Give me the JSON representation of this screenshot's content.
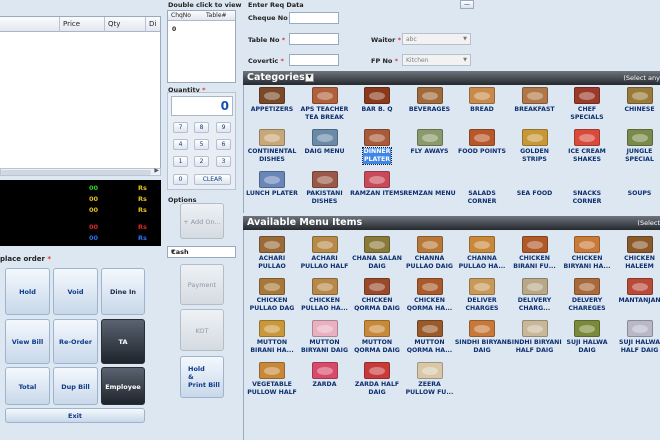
{
  "order_grid": {
    "columns": [
      "",
      "Price",
      "Qty",
      "Di"
    ]
  },
  "totals": {
    "rows": [
      {
        "value": "00",
        "value_color": "#28d428",
        "rs": "Rs",
        "rs_color": "#e8c020"
      },
      {
        "value": "00",
        "value_color": "#e8c020",
        "rs": "Rs",
        "rs_color": "#e8c020"
      },
      {
        "value": "00",
        "value_color": "#e8c020",
        "rs": "Rs",
        "rs_color": "#e8c020"
      },
      {
        "value": "00",
        "value_color": "#e02828",
        "rs": "Rs",
        "rs_color": "#e02828"
      },
      {
        "value": "00",
        "value_color": "#3070f0",
        "rs": "Rs",
        "rs_color": "#3070f0"
      }
    ]
  },
  "place_order": {
    "label": "place order",
    "req": "*",
    "buttons": {
      "hold": "Hold",
      "void": "Void",
      "dine_in": "Dine In",
      "view_bill": "View Bill",
      "re_order": "Re-Order",
      "ta": "TA",
      "total": "Total",
      "dup_bill": "Dup Bill",
      "employee": "Employee",
      "exit": "Exit"
    }
  },
  "cheques": {
    "hint": "Double click to view",
    "col_chq": "ChqNo",
    "col_table": "Table#",
    "first_value": "0"
  },
  "quantity": {
    "label": "Quantity",
    "req": "*",
    "value": "0",
    "keys": [
      "7",
      "8",
      "9",
      "4",
      "5",
      "6",
      "1",
      "2",
      "3",
      "0"
    ],
    "clear": "CLEAR"
  },
  "options": {
    "label": "Options",
    "add_on": "+ Add On...",
    "payment_selected": "Cash",
    "payment": "Payment",
    "kot": "KOT",
    "hold_print": [
      "Hold",
      "&",
      "Print Bill"
    ]
  },
  "req_form": {
    "title": "Enter Req Data",
    "collapse": "—",
    "cheque_no": "Cheque No",
    "table_no": "Table No",
    "covertic": "Covertic",
    "waitor": "Waitor",
    "waitor_value": "abc",
    "fp_no": "FP No",
    "fp_value": "Kitchen",
    "req": "*"
  },
  "categories": {
    "title": "Categories",
    "right_text": "(Select any",
    "selected_index": 10,
    "items": [
      {
        "label": [
          "APPETIZERS"
        ],
        "color": "#7a4a28"
      },
      {
        "label": [
          "APS TEACHER",
          "TEA BREAK"
        ],
        "color": "#b0603a"
      },
      {
        "label": [
          "BAR B. Q"
        ],
        "color": "#8a3a1c"
      },
      {
        "label": [
          "BEVERAGES"
        ],
        "color": "#a06a3a"
      },
      {
        "label": [
          "BREAD"
        ],
        "color": "#c88a4a"
      },
      {
        "label": [
          "BREAKFAST"
        ],
        "color": "#b07848"
      },
      {
        "label": [
          "CHEF",
          "SPECIALS"
        ],
        "color": "#9a3a2a"
      },
      {
        "label": [
          "CHINESE"
        ],
        "color": "#9a7a3a"
      },
      {
        "label": [
          "CONTINENTAL",
          "DISHES"
        ],
        "color": "#c8a878"
      },
      {
        "label": [
          "DAIG MENU"
        ],
        "color": "#6a8aa8"
      },
      {
        "label": [
          "DINNER",
          "PLATER"
        ],
        "color": "#a85a3a"
      },
      {
        "label": [
          "FLY AWAYS"
        ],
        "color": "#8a9a6a"
      },
      {
        "label": [
          "FOOD POINTS"
        ],
        "color": "#b8582a"
      },
      {
        "label": [
          "GOLDEN",
          "STRIPS"
        ],
        "color": "#c89838"
      },
      {
        "label": [
          "ICE CREAM",
          "SHAKES"
        ],
        "color": "#d84a3a"
      },
      {
        "label": [
          "JUNGLE",
          "SPECIAL"
        ],
        "color": "#7a8a4a"
      },
      {
        "label": [
          "LUNCH PLATER"
        ],
        "color": "#6a86b8"
      },
      {
        "label": [
          "PAKISTANI",
          "DISHES"
        ],
        "color": "#9a5848"
      },
      {
        "label": [
          "RAMZAN ITEMS"
        ],
        "color": "#c84a5a"
      },
      {
        "label": [
          "REMZAN MENU"
        ],
        "color": ""
      },
      {
        "label": [
          "SALADS",
          "CORNER"
        ],
        "color": ""
      },
      {
        "label": [
          "SEA FOOD"
        ],
        "color": ""
      },
      {
        "label": [
          "SNACKS",
          "CORNER"
        ],
        "color": ""
      },
      {
        "label": [
          "SOUPS"
        ],
        "color": ""
      }
    ]
  },
  "menu_items": {
    "title": "Available Menu Items",
    "right_text": "(Select",
    "items": [
      {
        "label": [
          "ACHARI",
          "PULLAO"
        ],
        "color": "#9a6a3a"
      },
      {
        "label": [
          "ACHARI",
          "PULLAO HALF"
        ],
        "color": "#b88a4a"
      },
      {
        "label": [
          "CHANA SALAN",
          "DAIG"
        ],
        "color": "#8a7a3a"
      },
      {
        "label": [
          "CHANNA",
          "PULLAO DAIG"
        ],
        "color": "#b8783a"
      },
      {
        "label": [
          "CHANNA",
          "PULLAO HA..."
        ],
        "color": "#c8883a"
      },
      {
        "label": [
          "CHICKEN",
          "BIRANI FU..."
        ],
        "color": "#b05a2a"
      },
      {
        "label": [
          "CHICKEN",
          "BIRYANI HA..."
        ],
        "color": "#c87a3a"
      },
      {
        "label": [
          "CHICKEN",
          "HALEEM"
        ],
        "color": "#8a5a2a"
      },
      {
        "label": [
          "CHICKEN",
          "PULLAO DAG"
        ],
        "color": "#a8783a"
      },
      {
        "label": [
          "CHICKEN",
          "PULLAO HA..."
        ],
        "color": "#b8884a"
      },
      {
        "label": [
          "CHICKEN",
          "QORMA DAIG"
        ],
        "color": "#9a4a2a"
      },
      {
        "label": [
          "CHICKEN",
          "QORMA HA..."
        ],
        "color": "#a85a2a"
      },
      {
        "label": [
          "DELIVER",
          "CHARGES"
        ],
        "color": "#c89a5a"
      },
      {
        "label": [
          "DELIVERY",
          "CHARG..."
        ],
        "color": "#b8a888"
      },
      {
        "label": [
          "DELVERY",
          "CHAREGES"
        ],
        "color": "#a86a3a"
      },
      {
        "label": [
          "MANTANJAN"
        ],
        "color": "#b84a3a"
      },
      {
        "label": [
          "MUTTON",
          "BIRANI HA..."
        ],
        "color": "#c8983a"
      },
      {
        "label": [
          "MUTTON",
          "BIRYANI DAIG"
        ],
        "color": "#e8b0c0"
      },
      {
        "label": [
          "MUTTON",
          "QORMA DAIG"
        ],
        "color": "#c88a3a"
      },
      {
        "label": [
          "MUTTON",
          "QORMA HA..."
        ],
        "color": "#9a5a2a"
      },
      {
        "label": [
          "SINDHI BIRYANI",
          "DAIG"
        ],
        "color": "#c8783a"
      },
      {
        "label": [
          "SINDHI BIRYANI",
          "HALF DAIG"
        ],
        "color": "#c8b898"
      },
      {
        "label": [
          "SUJI HALWA",
          "DAIG"
        ],
        "color": "#7a8a3a"
      },
      {
        "label": [
          "SUJI HALWA",
          "HALF DAIG"
        ],
        "color": "#b8b8c8"
      },
      {
        "label": [
          "VEGETABLE",
          "PULLOW HALF"
        ],
        "color": "#c8883a"
      },
      {
        "label": [
          "ZARDA"
        ],
        "color": "#d84a6a"
      },
      {
        "label": [
          "ZARDA HALF",
          "DAIG"
        ],
        "color": "#c83a3a"
      },
      {
        "label": [
          "ZEERA",
          "PULLOW FU..."
        ],
        "color": "#d8c8a8"
      }
    ]
  }
}
